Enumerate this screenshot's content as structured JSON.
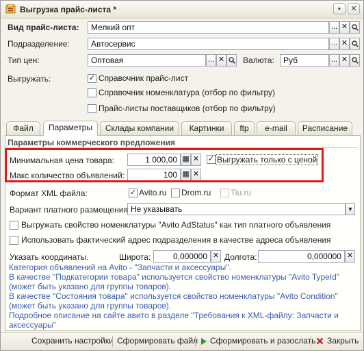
{
  "window": {
    "title": "Выгрузка прайс-листа *",
    "btn_menu": "▪",
    "btn_close": "✕"
  },
  "form": {
    "vid_label": "Вид прайс-листа:",
    "vid_value": "Мелкий опт",
    "podr_label": "Подразделение:",
    "podr_value": "Автосервис",
    "tip_label": "Тип цен:",
    "tip_value": "Оптовая",
    "valuta_label": "Валюта:",
    "valuta_value": "Руб",
    "vygruzhat_label": "Выгружать:",
    "chk_spravochnik": "Справочник прайс-лист",
    "chk_nomenklatura": "Справочник номенклатура (отбор по фильтру)",
    "chk_postavshiki": "Прайс-листы поставщиков (отбор по фильтру)"
  },
  "icons": {
    "dots": "...",
    "clear": "✕",
    "search": "🔍",
    "check": "✓",
    "calc": "▦",
    "down": "▼",
    "save": "▶",
    "close": "✖"
  },
  "tabs": [
    "Файл",
    "Параметры",
    "Склады компании",
    "Картинки",
    "ftp",
    "e-mail",
    "Расписание"
  ],
  "params": {
    "section_title": "Параметры коммерческого предложения",
    "min_price_label": "Минимальная цена товара:",
    "min_price_value": "1 000,00",
    "only_with_price_label": "Выгружать только с ценой",
    "max_count_label": "Макс количество объявлений:",
    "max_count_value": "100",
    "xml_label": "Формат XML файла:",
    "xml_avito": "Avito.ru",
    "xml_drom": "Drom.ru",
    "xml_tiu": "Tiu.ru",
    "placement_label": "Вариант платного размещения:",
    "placement_value": "Не указывать",
    "chk_adstatus": "Выгружать свойство номенклатуры \"Avito AdStatus\" как тип платного объявления",
    "chk_address": "Использовать фактический адрес подразделения в качестве адреса объявления",
    "coords_label": "Указать координаты.",
    "lat_label": "Широта:",
    "lat_value": "0,000000",
    "lon_label": "Долгота:",
    "lon_value": "0,000000",
    "info_1": "Категория объявлений на Avito - \"Запчасти и аксессуары\".",
    "info_2": "В качестве \"Подкатегории товара\" используется свойство номенклатуры \"Avito TypeId\" (может быть указано для группы товаров).",
    "info_3": "В качестве \"Состояния товара\" используется свойство номенклатуры \"Avito Condition\" (может быть указано для группы товаров).",
    "info_4": "Подробное описание на сайте авито в разделе \"Требования к XML-файлу: Запчасти и аксессуары\""
  },
  "footer": {
    "save_settings": "Сохранить настройки",
    "make_file": "Сформировать файл",
    "make_and_send": "Сформировать и разослать",
    "close": "Закрыть"
  },
  "colors": {
    "accent_link": "#3a5cb0",
    "highlight_box": "#e01818",
    "go_green": "#2f9a2a",
    "close_red": "#c42a2a"
  }
}
